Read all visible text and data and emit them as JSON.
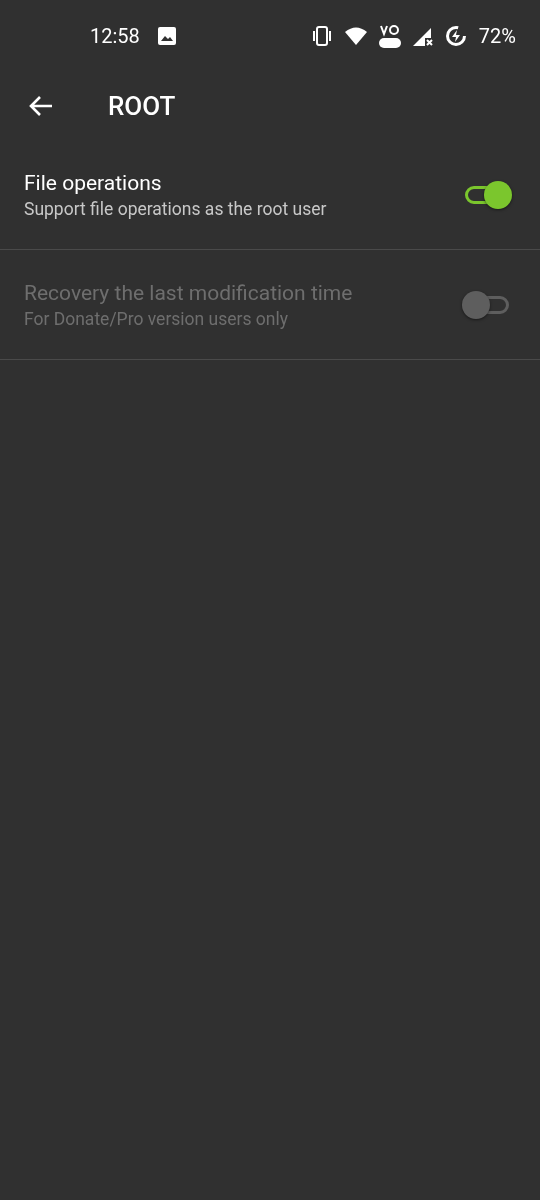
{
  "status_bar": {
    "time": "12:58",
    "battery": "72%"
  },
  "toolbar": {
    "title": "ROOT"
  },
  "settings": [
    {
      "title": "File operations",
      "summary": "Support file operations as the root user",
      "on": true,
      "disabled": false
    },
    {
      "title": "Recovery the last modification time",
      "summary": "For Donate/Pro version users only",
      "on": false,
      "disabled": true
    }
  ]
}
